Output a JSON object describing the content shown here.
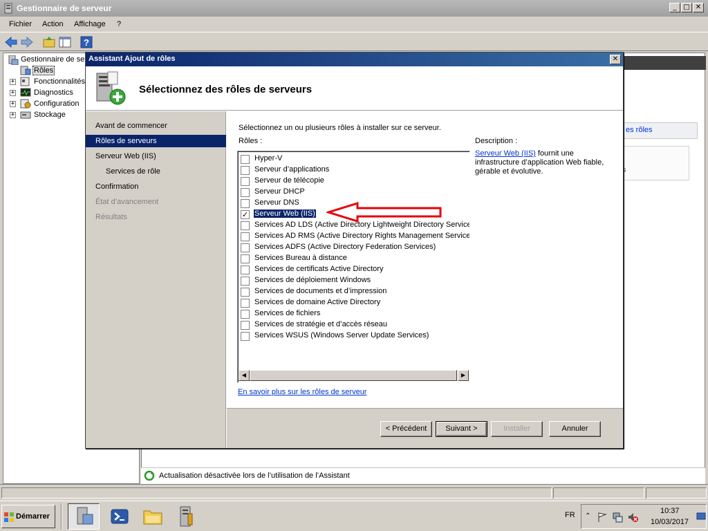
{
  "main_window": {
    "title": "Gestionnaire de serveur",
    "menu": [
      "Fichier",
      "Action",
      "Affichage",
      "?"
    ]
  },
  "tree": {
    "root": "Gestionnaire de ser",
    "items": [
      {
        "label": "Rôles",
        "expander": ""
      },
      {
        "label": "Fonctionnalités",
        "expander": "+"
      },
      {
        "label": "Diagnostics",
        "expander": "+"
      },
      {
        "label": "Configuration",
        "expander": "+"
      },
      {
        "label": "Stockage",
        "expander": "+"
      }
    ]
  },
  "right_pane": {
    "link": "es rôles",
    "fragment": "s"
  },
  "status": {
    "text": "Actualisation désactivée lors de l’utilisation de l’Assistant"
  },
  "dialog": {
    "title": "Assistant Ajout de rôles",
    "heading": "Sélectionnez des rôles de serveurs",
    "nav": [
      {
        "label": "Avant de commencer",
        "state": "normal"
      },
      {
        "label": "Rôles de serveurs",
        "state": "selected"
      },
      {
        "label": "Serveur Web (IIS)",
        "state": "normal"
      },
      {
        "label": "Services de rôle",
        "state": "sub"
      },
      {
        "label": "Confirmation",
        "state": "normal"
      },
      {
        "label": "État d’avancement",
        "state": "disabled"
      },
      {
        "label": "Résultats",
        "state": "disabled"
      }
    ],
    "instruction": "Sélectionnez un ou plusieurs rôles à installer sur ce serveur.",
    "roles_label": "Rôles :",
    "roles": [
      {
        "label": "Hyper-V",
        "checked": false
      },
      {
        "label": "Serveur d’applications",
        "checked": false
      },
      {
        "label": "Serveur de télécopie",
        "checked": false
      },
      {
        "label": "Serveur DHCP",
        "checked": false
      },
      {
        "label": "Serveur DNS",
        "checked": false
      },
      {
        "label": "Serveur Web (IIS)",
        "checked": true,
        "selected": true
      },
      {
        "label": "Services AD LDS (Active Directory Lightweight Directory Services)",
        "checked": false
      },
      {
        "label": "Services AD RMS (Active Directory Rights Management Services)",
        "checked": false
      },
      {
        "label": "Services ADFS (Active Directory Federation Services)",
        "checked": false
      },
      {
        "label": "Services Bureau à distance",
        "checked": false
      },
      {
        "label": "Services de certificats Active Directory",
        "checked": false
      },
      {
        "label": "Services de déploiement Windows",
        "checked": false
      },
      {
        "label": "Services de documents et d’impression",
        "checked": false
      },
      {
        "label": "Services de domaine Active Directory",
        "checked": false
      },
      {
        "label": "Services de fichiers",
        "checked": false
      },
      {
        "label": "Services de stratégie et d’accès réseau",
        "checked": false
      },
      {
        "label": "Services WSUS (Windows Server Update Services)",
        "checked": false
      }
    ],
    "description_label": "Description :",
    "description_link": "Serveur Web (IIS)",
    "description_text": " fournit une infrastructure d’application Web fiable, gérable et évolutive.",
    "more_link": "En savoir plus sur les rôles de serveur",
    "buttons": {
      "previous": "< Précédent",
      "next": "Suivant >",
      "install": "Installer",
      "cancel": "Annuler"
    }
  },
  "taskbar": {
    "start": "Démarrer",
    "lang": "FR",
    "time": "10:37",
    "date": "10/03/2017"
  },
  "colors": {
    "selection": "#0a246a",
    "arrow": "#e8000b",
    "link": "#0033cc"
  }
}
